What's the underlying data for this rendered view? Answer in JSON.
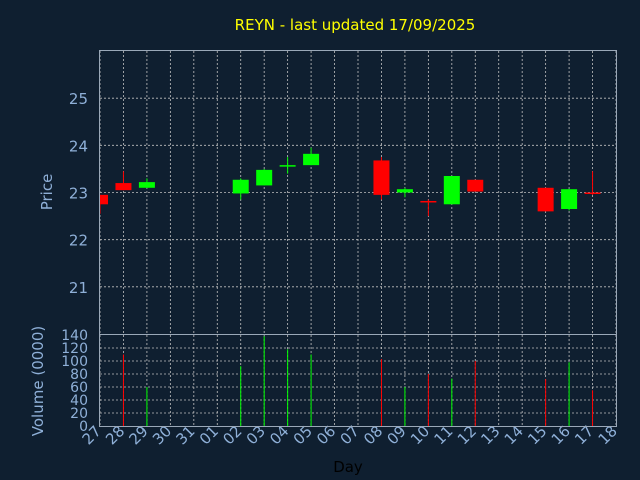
{
  "chart_data": {
    "type": "candlestick",
    "title": "REYN - last updated 17/09/2025",
    "xlabel": "Day",
    "ylabel": "Price",
    "volume_label": "Volume (0000)",
    "x_ticks": [
      "27",
      "28",
      "29",
      "30",
      "31",
      "01",
      "02",
      "03",
      "04",
      "05",
      "06",
      "07",
      "08",
      "09",
      "10",
      "11",
      "12",
      "13",
      "14",
      "15",
      "16",
      "17",
      "18"
    ],
    "price_ylim": [
      20,
      26
    ],
    "price_ticks": [
      21,
      22,
      23,
      24,
      25
    ],
    "volume_ylim": [
      0,
      140
    ],
    "volume_ticks": [
      0,
      20,
      40,
      60,
      80,
      100,
      120,
      140
    ],
    "grid": true,
    "colors": {
      "background": "#0f1f30",
      "up": "#00ff00",
      "down": "#ff0000",
      "text": "#8fb0d8",
      "title": "#ffff00",
      "grid": "#c0c0c0"
    },
    "candles": [
      {
        "day": "27",
        "open": 22.95,
        "high": 22.95,
        "low": 22.55,
        "close": 22.75
      },
      {
        "day": "28",
        "open": 23.2,
        "high": 23.45,
        "low": 23.05,
        "close": 23.05
      },
      {
        "day": "29",
        "open": 23.1,
        "high": 23.3,
        "low": 23.1,
        "close": 23.22
      },
      {
        "day": "02",
        "open": 22.98,
        "high": 23.3,
        "low": 22.85,
        "close": 23.27
      },
      {
        "day": "03",
        "open": 23.15,
        "high": 23.5,
        "low": 23.15,
        "close": 23.48
      },
      {
        "day": "04",
        "open": 23.55,
        "high": 23.75,
        "low": 23.4,
        "close": 23.58
      },
      {
        "day": "05",
        "open": 23.58,
        "high": 23.95,
        "low": 23.58,
        "close": 23.82
      },
      {
        "day": "08",
        "open": 23.68,
        "high": 23.75,
        "low": 22.85,
        "close": 22.95
      },
      {
        "day": "09",
        "open": 23.0,
        "high": 23.1,
        "low": 22.9,
        "close": 23.07
      },
      {
        "day": "10",
        "open": 22.82,
        "high": 22.85,
        "low": 22.5,
        "close": 22.8
      },
      {
        "day": "11",
        "open": 22.75,
        "high": 23.35,
        "low": 22.75,
        "close": 23.35
      },
      {
        "day": "12",
        "open": 23.27,
        "high": 23.27,
        "low": 23.02,
        "close": 23.02
      },
      {
        "day": "15",
        "open": 23.1,
        "high": 23.1,
        "low": 22.6,
        "close": 22.6
      },
      {
        "day": "16",
        "open": 22.65,
        "high": 23.07,
        "low": 22.62,
        "close": 23.07
      },
      {
        "day": "17",
        "open": 23.0,
        "high": 23.45,
        "low": 22.95,
        "close": 22.97
      }
    ],
    "volume": [
      {
        "day": "28",
        "value": 110,
        "dir": "down"
      },
      {
        "day": "29",
        "value": 60,
        "dir": "up"
      },
      {
        "day": "02",
        "value": 92,
        "dir": "up"
      },
      {
        "day": "03",
        "value": 138,
        "dir": "up"
      },
      {
        "day": "04",
        "value": 118,
        "dir": "up"
      },
      {
        "day": "05",
        "value": 110,
        "dir": "up"
      },
      {
        "day": "08",
        "value": 103,
        "dir": "down"
      },
      {
        "day": "09",
        "value": 60,
        "dir": "up"
      },
      {
        "day": "10",
        "value": 80,
        "dir": "down"
      },
      {
        "day": "11",
        "value": 73,
        "dir": "up"
      },
      {
        "day": "12",
        "value": 100,
        "dir": "down"
      },
      {
        "day": "15",
        "value": 72,
        "dir": "down"
      },
      {
        "day": "16",
        "value": 98,
        "dir": "up"
      },
      {
        "day": "17",
        "value": 55,
        "dir": "down"
      }
    ]
  }
}
